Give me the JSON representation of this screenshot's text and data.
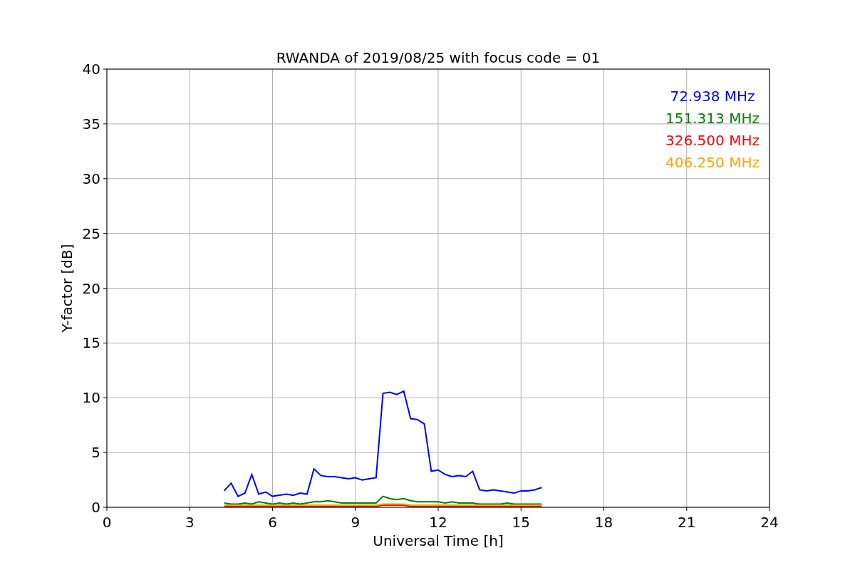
{
  "figure": {
    "chart_data": {
      "type": "line",
      "title": "RWANDA of 2019/08/25 with focus code = 01",
      "xlabel": "Universal Time [h]",
      "ylabel": "Y-factor [dB]",
      "x": [
        4.25,
        4.5,
        4.75,
        5.0,
        5.25,
        5.5,
        5.75,
        6.0,
        6.25,
        6.5,
        6.75,
        7.0,
        7.25,
        7.5,
        7.75,
        8.0,
        8.25,
        8.5,
        8.75,
        9.0,
        9.25,
        9.5,
        9.75,
        10.0,
        10.25,
        10.5,
        10.75,
        11.0,
        11.25,
        11.5,
        11.75,
        12.0,
        12.25,
        12.5,
        12.75,
        13.0,
        13.25,
        13.5,
        13.75,
        14.0,
        14.25,
        14.5,
        14.75,
        15.0,
        15.25,
        15.5,
        15.75
      ],
      "series": [
        {
          "name": "72.938 MHz",
          "color": "#0000ff",
          "values": [
            1.5,
            2.2,
            1.0,
            1.3,
            3.0,
            1.2,
            1.4,
            1.0,
            1.1,
            1.2,
            1.1,
            1.3,
            1.2,
            3.5,
            2.9,
            2.8,
            2.8,
            2.7,
            2.6,
            2.7,
            2.5,
            2.6,
            2.7,
            10.4,
            10.5,
            10.3,
            10.6,
            8.1,
            8.0,
            7.6,
            3.3,
            3.4,
            3.0,
            2.8,
            2.9,
            2.8,
            3.3,
            1.6,
            1.5,
            1.6,
            1.5,
            1.4,
            1.3,
            1.5,
            1.5,
            1.6,
            1.8
          ]
        },
        {
          "name": "151.313 MHz",
          "color": "#008000",
          "values": [
            0.4,
            0.3,
            0.3,
            0.4,
            0.3,
            0.5,
            0.4,
            0.3,
            0.4,
            0.3,
            0.4,
            0.3,
            0.4,
            0.5,
            0.5,
            0.6,
            0.5,
            0.4,
            0.4,
            0.4,
            0.4,
            0.4,
            0.4,
            1.0,
            0.8,
            0.7,
            0.8,
            0.6,
            0.5,
            0.5,
            0.5,
            0.5,
            0.4,
            0.5,
            0.4,
            0.4,
            0.4,
            0.3,
            0.3,
            0.3,
            0.3,
            0.4,
            0.3,
            0.3,
            0.3,
            0.3,
            0.3
          ]
        },
        {
          "name": "326.500 MHz",
          "color": "#ff0000",
          "values": [
            0.1,
            0.1,
            0.1,
            0.1,
            0.1,
            0.1,
            0.1,
            0.1,
            0.1,
            0.1,
            0.1,
            0.1,
            0.1,
            0.1,
            0.1,
            0.1,
            0.1,
            0.1,
            0.1,
            0.1,
            0.1,
            0.1,
            0.1,
            0.2,
            0.2,
            0.2,
            0.2,
            0.1,
            0.1,
            0.1,
            0.1,
            0.1,
            0.1,
            0.1,
            0.1,
            0.1,
            0.1,
            0.1,
            0.1,
            0.1,
            0.1,
            0.1,
            0.1,
            0.1,
            0.1,
            0.1,
            0.1
          ]
        },
        {
          "name": "406.250 MHz",
          "color": "#ffa500",
          "values": [
            0.2,
            0.2,
            0.2,
            0.2,
            0.2,
            0.2,
            0.2,
            0.2,
            0.2,
            0.2,
            0.2,
            0.2,
            0.2,
            0.2,
            0.2,
            0.2,
            0.2,
            0.2,
            0.2,
            0.2,
            0.2,
            0.2,
            0.2,
            0.3,
            0.3,
            0.3,
            0.3,
            0.2,
            0.2,
            0.2,
            0.2,
            0.2,
            0.2,
            0.2,
            0.2,
            0.2,
            0.2,
            0.2,
            0.2,
            0.2,
            0.2,
            0.2,
            0.2,
            0.2,
            0.2,
            0.2,
            0.2
          ]
        }
      ],
      "grid": true,
      "xlim": [
        0,
        24
      ],
      "ylim": [
        0,
        40
      ],
      "xticks": [
        0,
        3,
        6,
        9,
        12,
        15,
        18,
        21,
        24
      ],
      "yticks": [
        0,
        5,
        10,
        15,
        20,
        25,
        30,
        35,
        40
      ]
    }
  }
}
